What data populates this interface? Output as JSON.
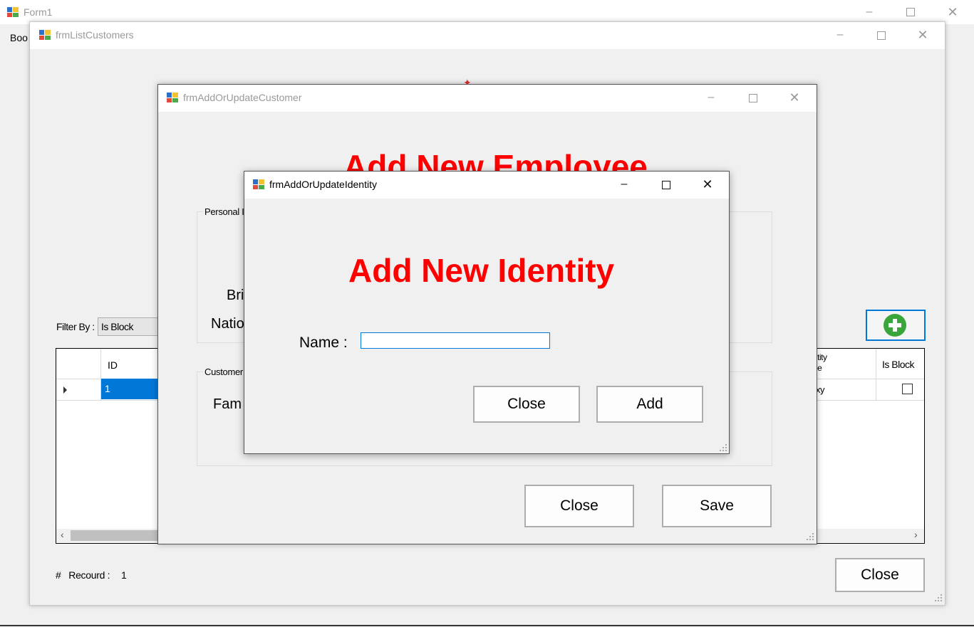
{
  "form1": {
    "title": "Form1",
    "menu_partial": "Boo"
  },
  "list_window": {
    "title": "frmListCustomers",
    "filter_label": "Filter By :",
    "filter_value": "Is Block",
    "grid": {
      "columns": [
        "",
        "ID",
        "ntity\npe",
        "Is Block"
      ],
      "row_id": "1",
      "row_partial_identity": "xy"
    },
    "record_label": "#   Recourd :",
    "record_count": "1",
    "close_label": "Close",
    "add_button_color": "#3aa53a"
  },
  "customer_window": {
    "title": "frmAddOrUpdateCustomer",
    "heading": "Add New Employee",
    "personal_group_label": "Personal I",
    "customer_group_label": "Customer",
    "label_bri": "Bri",
    "label_natio": "Natio",
    "label_fam": "Fam",
    "close_label": "Close",
    "save_label": "Save"
  },
  "identity_window": {
    "title": "frmAddOrUpdateIdentity",
    "heading": "Add New Identity",
    "name_label": "Name :",
    "name_value": "",
    "close_label": "Close",
    "add_label": "Add",
    "heading_color": "#ff0000"
  }
}
